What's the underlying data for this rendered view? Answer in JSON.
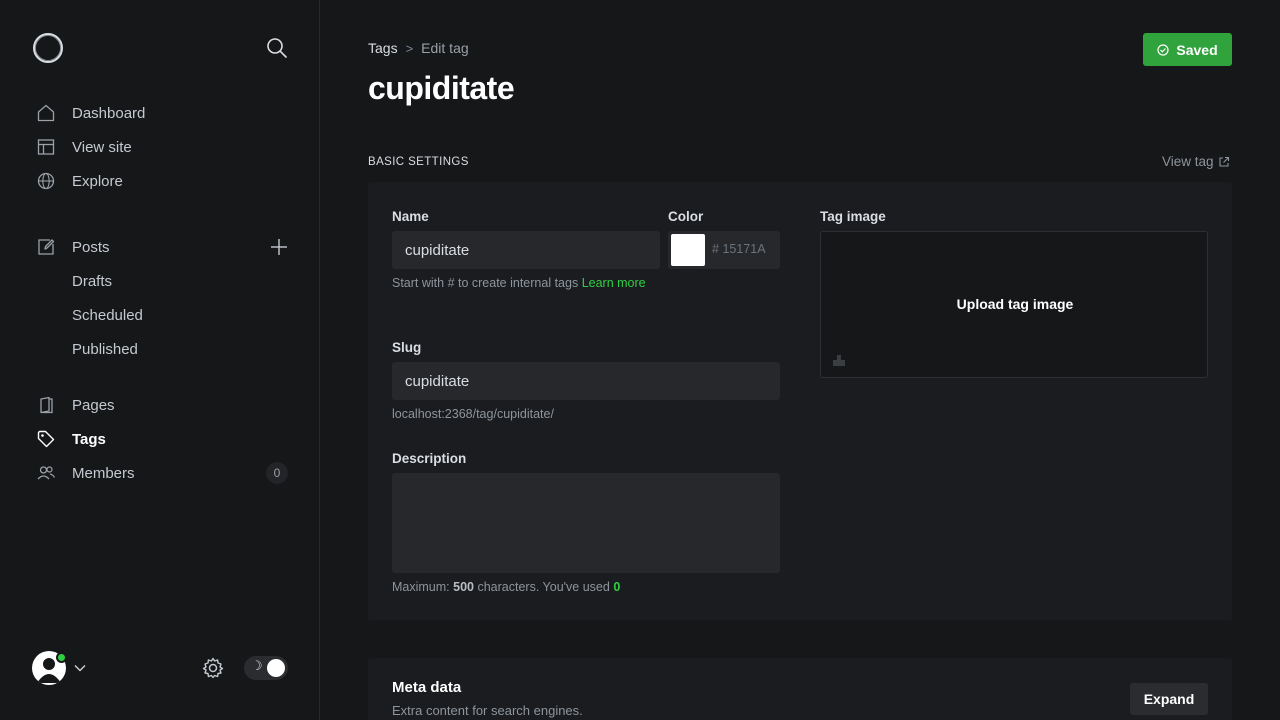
{
  "sidebar": {
    "logo_icon": "ghost-logo",
    "search_icon": "search-icon",
    "nav_primary": [
      {
        "label": "Dashboard",
        "icon": "home-icon"
      },
      {
        "label": "View site",
        "icon": "layout-icon"
      },
      {
        "label": "Explore",
        "icon": "globe-icon"
      }
    ],
    "posts": {
      "label": "Posts",
      "icon": "edit-icon",
      "add_icon": "plus-icon",
      "sub_items": [
        {
          "label": "Drafts"
        },
        {
          "label": "Scheduled"
        },
        {
          "label": "Published"
        }
      ]
    },
    "nav_secondary": [
      {
        "label": "Pages",
        "icon": "pages-icon"
      },
      {
        "label": "Tags",
        "icon": "tag-icon",
        "active": true
      },
      {
        "label": "Members",
        "icon": "members-icon",
        "count": "0"
      }
    ],
    "footer": {
      "avatar_status_color": "#30cf43",
      "settings_icon": "gear-icon",
      "theme_toggle_icon": "moon-icon"
    }
  },
  "header": {
    "breadcrumb": {
      "parent": "Tags",
      "separator": ">",
      "current": "Edit tag"
    },
    "title": "cupiditate",
    "saved_button": {
      "label": "Saved",
      "icon": "check-circle-icon",
      "color": "#30a33d"
    }
  },
  "basic_settings": {
    "section_label": "BASIC SETTINGS",
    "view_tag_label": "View tag",
    "name": {
      "label": "Name",
      "value": "cupiditate",
      "help_text": "Start with # to create internal tags",
      "help_link": "Learn more"
    },
    "color": {
      "label": "Color",
      "swatch": "#ffffff",
      "hash": "#",
      "placeholder": "15171A"
    },
    "slug": {
      "label": "Slug",
      "value": "cupiditate",
      "url_preview": "localhost:2368/tag/cupiditate/"
    },
    "description": {
      "label": "Description",
      "value": "",
      "counter_prefix": "Maximum:",
      "max": "500",
      "counter_middle": "characters. You've used",
      "used": "0"
    },
    "tag_image": {
      "label": "Tag image",
      "upload_label": "Upload tag image"
    }
  },
  "meta_data": {
    "title": "Meta data",
    "subtitle": "Extra content for search engines.",
    "expand_label": "Expand"
  },
  "colors": {
    "background": "#151719",
    "accent": "#30cf43"
  }
}
